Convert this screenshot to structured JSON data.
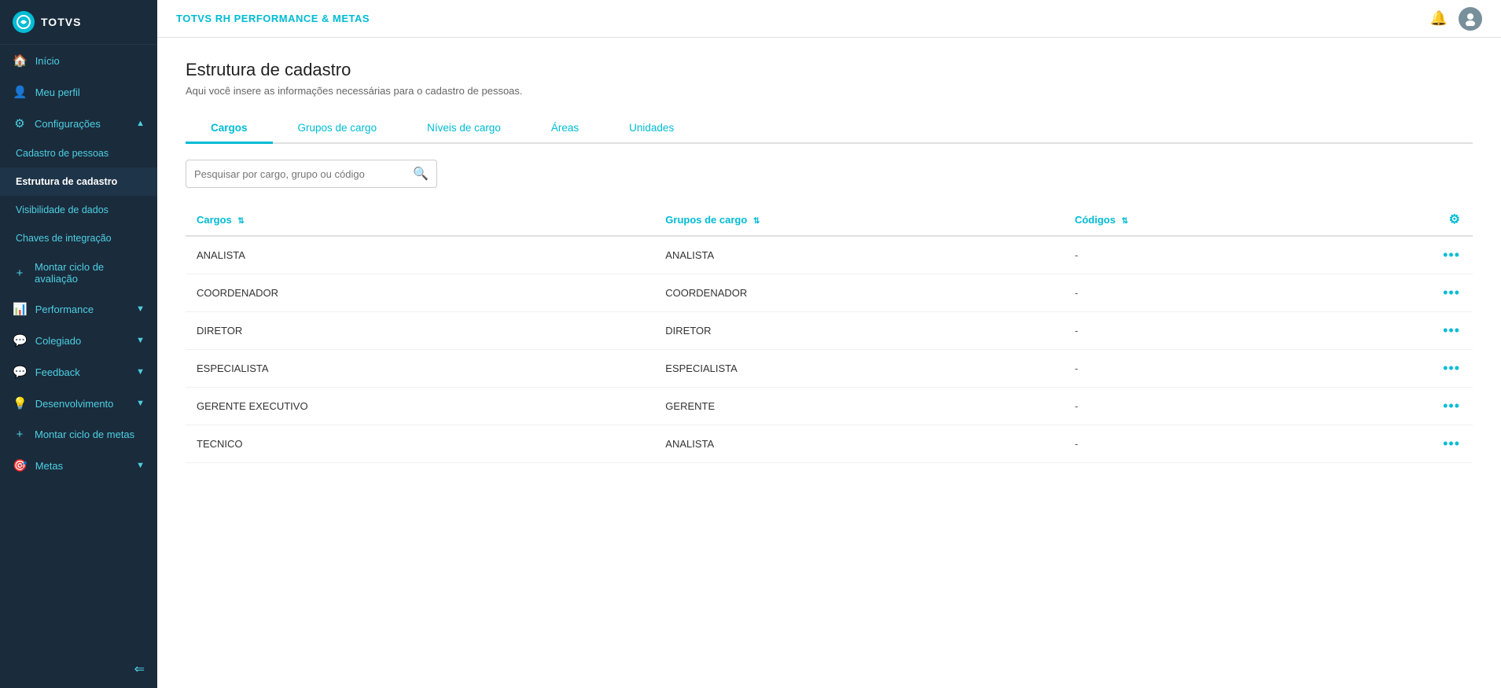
{
  "app": {
    "logo_text": "TOTVS",
    "topbar_title": "TOTVS RH PERFORMANCE & METAS"
  },
  "sidebar": {
    "items": [
      {
        "id": "inicio",
        "label": "Início",
        "icon": "🏠",
        "type": "main"
      },
      {
        "id": "meu-perfil",
        "label": "Meu perfil",
        "icon": "👤",
        "type": "main"
      },
      {
        "id": "configuracoes",
        "label": "Configurações",
        "icon": "⚙",
        "type": "main",
        "has_chevron": true,
        "expanded": true
      },
      {
        "id": "cadastro-pessoas",
        "label": "Cadastro de pessoas",
        "icon": "",
        "type": "sub"
      },
      {
        "id": "estrutura-cadastro",
        "label": "Estrutura de cadastro",
        "icon": "",
        "type": "sub",
        "active": true
      },
      {
        "id": "visibilidade-dados",
        "label": "Visibilidade de dados",
        "icon": "",
        "type": "sub"
      },
      {
        "id": "chaves-integracao",
        "label": "Chaves de integração",
        "icon": "",
        "type": "sub"
      },
      {
        "id": "montar-ciclo-avaliacao",
        "label": "Montar ciclo de avaliação",
        "icon": "+",
        "type": "main"
      },
      {
        "id": "performance",
        "label": "Performance",
        "icon": "📊",
        "type": "main",
        "has_chevron": true
      },
      {
        "id": "colegiado",
        "label": "Colegiado",
        "icon": "💬",
        "type": "main",
        "has_chevron": true
      },
      {
        "id": "feedback",
        "label": "Feedback",
        "icon": "💬",
        "type": "main",
        "has_chevron": true
      },
      {
        "id": "desenvolvimento",
        "label": "Desenvolvimento",
        "icon": "💡",
        "type": "main",
        "has_chevron": true
      },
      {
        "id": "montar-ciclo-metas",
        "label": "Montar ciclo de metas",
        "icon": "+",
        "type": "main"
      },
      {
        "id": "metas",
        "label": "Metas",
        "icon": "🎯",
        "type": "main",
        "has_chevron": true
      }
    ],
    "collapse_icon": "⇐"
  },
  "page": {
    "title": "Estrutura de cadastro",
    "subtitle": "Aqui você insere as informações necessárias para o cadastro de pessoas."
  },
  "tabs": [
    {
      "id": "cargos",
      "label": "Cargos",
      "active": true
    },
    {
      "id": "grupos-cargo",
      "label": "Grupos de cargo",
      "active": false
    },
    {
      "id": "niveis-cargo",
      "label": "Níveis de cargo",
      "active": false
    },
    {
      "id": "areas",
      "label": "Áreas",
      "active": false
    },
    {
      "id": "unidades",
      "label": "Unidades",
      "active": false
    }
  ],
  "search": {
    "placeholder": "Pesquisar por cargo, grupo ou código"
  },
  "table": {
    "columns": [
      {
        "id": "cargos",
        "label": "Cargos",
        "sortable": true
      },
      {
        "id": "grupos-cargo",
        "label": "Grupos de cargo",
        "sortable": true
      },
      {
        "id": "codigos",
        "label": "Códigos",
        "sortable": true
      },
      {
        "id": "actions",
        "label": "",
        "is_settings": true
      }
    ],
    "rows": [
      {
        "cargo": "ANALISTA",
        "grupo": "ANALISTA",
        "codigo": "-"
      },
      {
        "cargo": "COORDENADOR",
        "grupo": "COORDENADOR",
        "codigo": "-"
      },
      {
        "cargo": "DIRETOR",
        "grupo": "DIRETOR",
        "codigo": "-"
      },
      {
        "cargo": "ESPECIALISTA",
        "grupo": "ESPECIALISTA",
        "codigo": "-"
      },
      {
        "cargo": "GERENTE EXECUTIVO",
        "grupo": "GERENTE",
        "codigo": "-"
      },
      {
        "cargo": "TECNICO",
        "grupo": "ANALISTA",
        "codigo": "-"
      }
    ]
  }
}
